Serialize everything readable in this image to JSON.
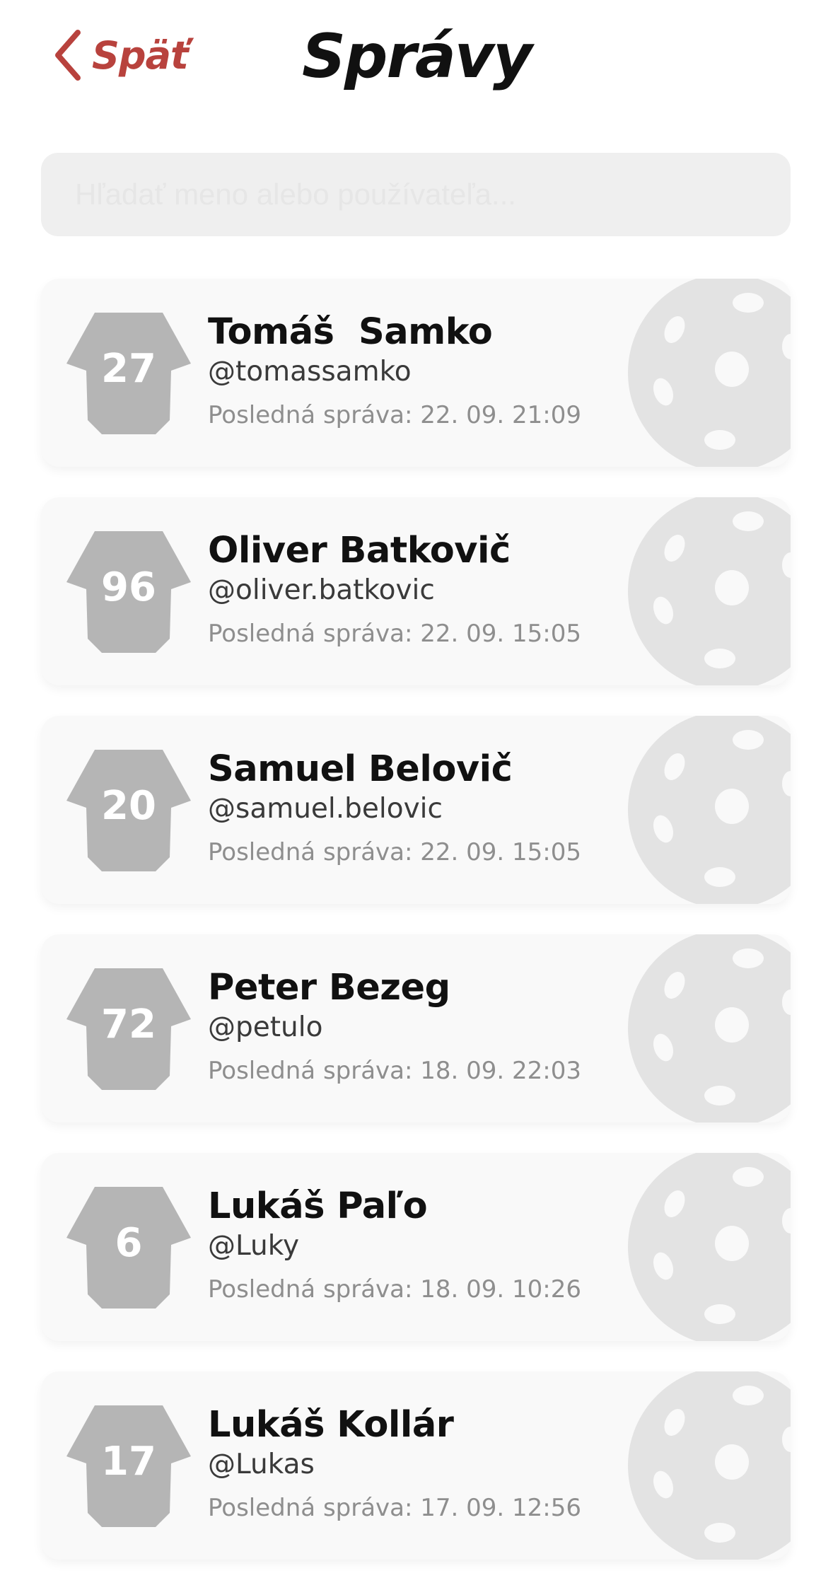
{
  "header": {
    "back_label": "Späť",
    "title": "Správy"
  },
  "search": {
    "placeholder": "Hľadať meno alebo používateľa...",
    "value": ""
  },
  "colors": {
    "accent": "#b8423d",
    "card_background": "#f9f9f9",
    "jersey": "#b5b5b5",
    "ball": "#e3e3e3"
  },
  "icons": {
    "back": "chevron-left-icon",
    "avatar": "jersey-icon",
    "decoration": "floorball-icon"
  },
  "contacts": [
    {
      "number": "27",
      "name": "Tomáš  Samko",
      "username": "@tomassamko",
      "last_message": "Posledná správa: 22. 09. 21:09"
    },
    {
      "number": "96",
      "name": "Oliver Batkovič",
      "username": "@oliver.batkovic",
      "last_message": "Posledná správa: 22. 09. 15:05"
    },
    {
      "number": "20",
      "name": "Samuel Belovič",
      "username": "@samuel.belovic",
      "last_message": "Posledná správa: 22. 09. 15:05"
    },
    {
      "number": "72",
      "name": "Peter Bezeg",
      "username": "@petulo",
      "last_message": "Posledná správa: 18. 09. 22:03"
    },
    {
      "number": "6",
      "name": "Lukáš Paľo",
      "username": "@Luky",
      "last_message": "Posledná správa: 18. 09. 10:26"
    },
    {
      "number": "17",
      "name": "Lukáš Kollár",
      "username": "@Lukas",
      "last_message": "Posledná správa: 17. 09. 12:56"
    }
  ]
}
